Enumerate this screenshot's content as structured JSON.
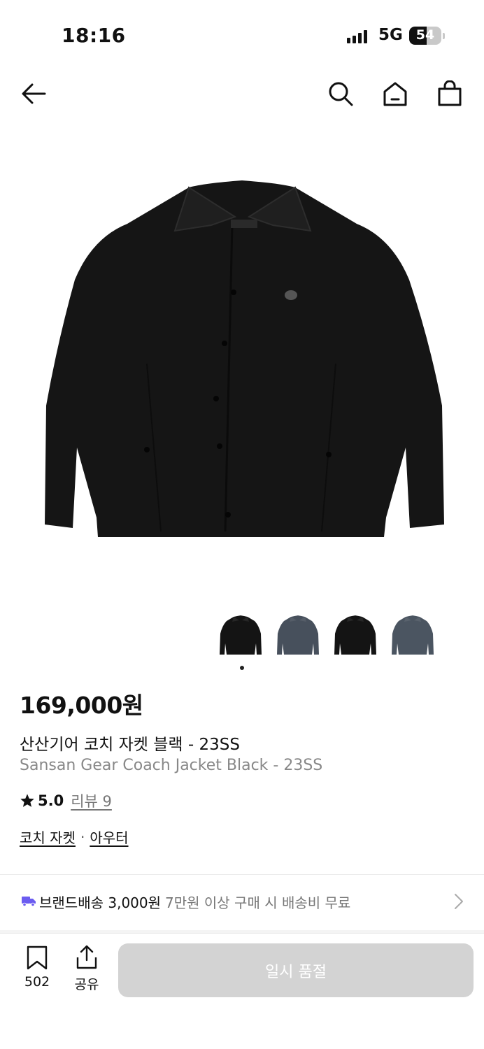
{
  "status_bar": {
    "time": "18:16",
    "network": "5G",
    "battery": "54",
    "battery_level": 0.54
  },
  "nav": {
    "back_icon": "arrow-left-icon",
    "search_icon": "search-icon",
    "home_icon": "home-icon",
    "cart_icon": "shopping-bag-icon"
  },
  "gallery": {
    "thumbnails": [
      {
        "color": "#141414"
      },
      {
        "color": "#47505c"
      },
      {
        "color": "#141414"
      },
      {
        "color": "#4b5561"
      }
    ],
    "dot_count": 1
  },
  "product": {
    "price": "169,000원",
    "name_ko": "산산기어 코치 자켓 블랙 - 23SS",
    "name_en": "Sansan Gear Coach Jacket Black - 23SS",
    "rating": "5.0",
    "review_link": "리뷰 9",
    "category_1": "코치 자켓",
    "category_sep": "·",
    "category_2": "아우터"
  },
  "shipping": {
    "icon": "truck-icon",
    "main": "브랜드배송 3,000원",
    "sub": "7만원 이상 구매 시 배송비 무료"
  },
  "bottom_bar": {
    "bookmark_count": "502",
    "share_label": "공유",
    "buy_label": "일시 품절"
  },
  "colors": {
    "accent_truck": "#6b5cf0",
    "disabled_button": "#d3d3d3"
  }
}
